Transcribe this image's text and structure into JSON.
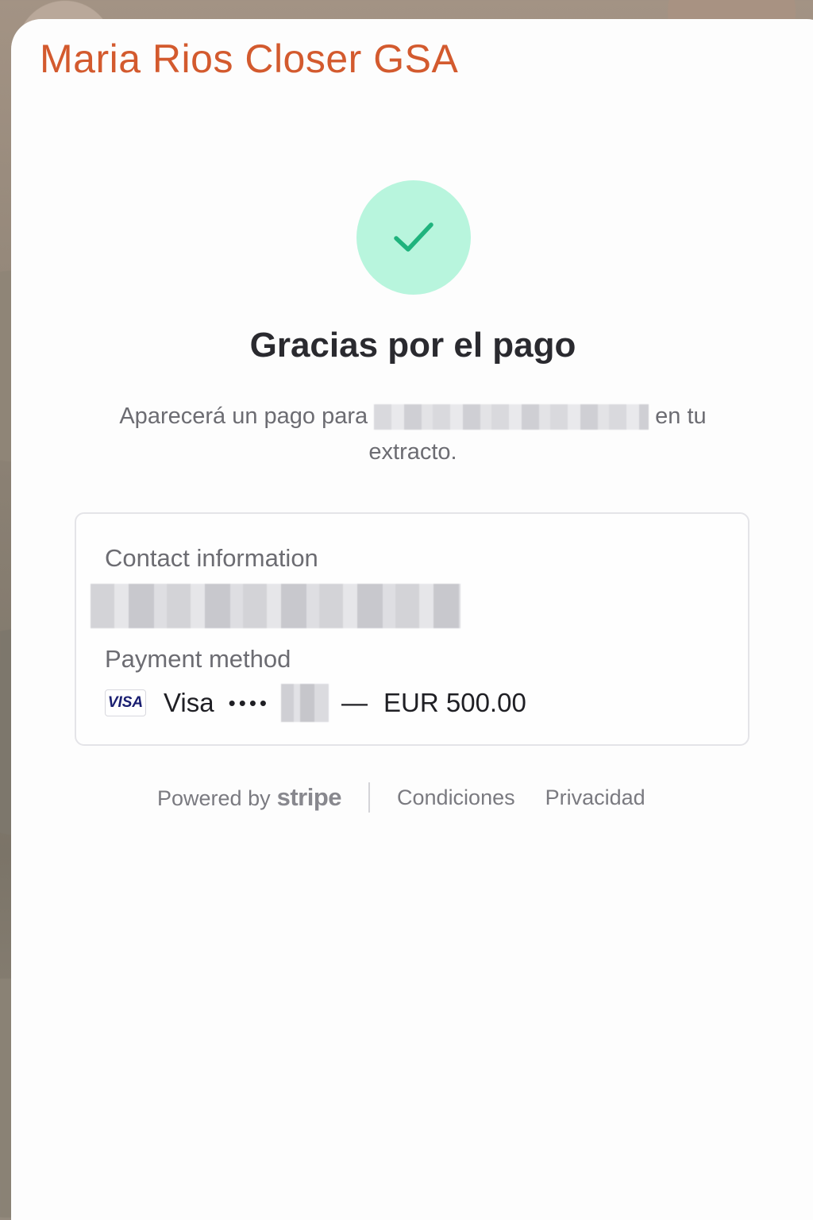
{
  "header": {
    "merchant_title": "Maria Rios Closer GSA"
  },
  "confirmation": {
    "icon": "check-icon",
    "heading": "Gracias por el pago",
    "message_prefix": "Aparecerá un pago para",
    "message_suffix": "en tu extracto.",
    "accent_color": "#1fb37d",
    "circle_color": "#b8f5dd"
  },
  "details": {
    "contact_label": "Contact information",
    "payment_label": "Payment method",
    "card_brand_badge": "VISA",
    "card_brand": "Visa",
    "masked_digits": "••••",
    "separator": "—",
    "amount": "EUR 500.00"
  },
  "footer": {
    "powered_by": "Powered by",
    "stripe_word": "stripe",
    "terms": "Condiciones",
    "privacy": "Privacidad"
  },
  "colors": {
    "brand": "#d35a2e",
    "text_dark": "#2a2a2f",
    "text_muted": "#6c6c72"
  }
}
